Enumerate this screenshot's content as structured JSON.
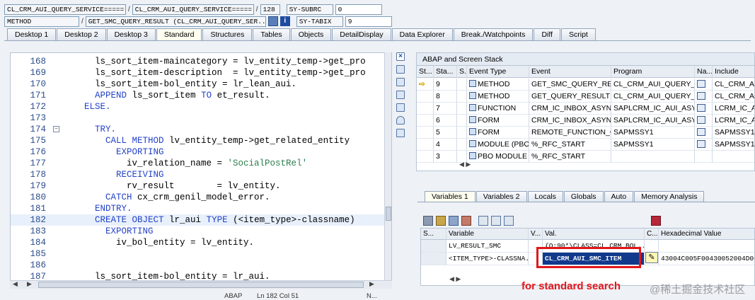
{
  "header": {
    "row1": {
      "field1": "CL_CRM_AUI_QUERY_SERVICE=====...",
      "field2": "CL_CRM_AUI_QUERY_SERVICE=====...",
      "line": "128",
      "sys_field": "SY-SUBRC",
      "sys_value": "0"
    },
    "row2": {
      "kind": "METHOD",
      "method": "GET_SMC_QUERY_RESULT (CL_CRM_AUI_QUERY_SER...",
      "sys_field": "SY-TABIX",
      "sys_value": "9"
    }
  },
  "tabs": [
    "Desktop 1",
    "Desktop 2",
    "Desktop 3",
    "Standard",
    "Structures",
    "Tables",
    "Objects",
    "DetailDisplay",
    "Data Explorer",
    "Break./Watchpoints",
    "Diff",
    "Script"
  ],
  "active_tab": "Standard",
  "code": [
    {
      "n": "168",
      "t": "      ls_sort_item-maincategory = lv_entity_temp->get_pro"
    },
    {
      "n": "169",
      "t": "      ls_sort_item-description  = lv_entity_temp->get_pro"
    },
    {
      "n": "170",
      "t": "      ls_sort_item-bol_entity = lr_lean_aui."
    },
    {
      "n": "171",
      "k": "APPEND",
      "t": " ls_sort_item ",
      "k2": "TO",
      "t2": " et_result.",
      "i": "      "
    },
    {
      "n": "172",
      "k": "ELSE.",
      "i": "    "
    },
    {
      "n": "173",
      "t": ""
    },
    {
      "n": "174",
      "k": "TRY.",
      "i": "      "
    },
    {
      "n": "175",
      "k": "CALL METHOD",
      "t": " lv_entity_temp->get_related_entity",
      "i": "        "
    },
    {
      "n": "176",
      "k": "EXPORTING",
      "i": "          "
    },
    {
      "n": "177",
      "t": "            iv_relation_name = ",
      "s": "'SocialPostRel'"
    },
    {
      "n": "178",
      "k": "RECEIVING",
      "i": "          "
    },
    {
      "n": "179",
      "t": "            rv_result        = lv_entity."
    },
    {
      "n": "180",
      "k": "CATCH",
      "t": " cx_crm_genil_model_error.",
      "i": "        "
    },
    {
      "n": "181",
      "k": "ENDTRY.",
      "i": "      "
    },
    {
      "n": "182",
      "k": "CREATE OBJECT",
      "t": " lr_aui ",
      "k2": "TYPE",
      "t2": " (<item_type>-classname)",
      "i": "      "
    },
    {
      "n": "183",
      "k": "EXPORTING",
      "i": "        "
    },
    {
      "n": "184",
      "t": "          iv_bol_entity = lv_entity."
    },
    {
      "n": "185",
      "t": ""
    },
    {
      "n": "186",
      "t": ""
    },
    {
      "n": "187",
      "t": "      ls_sort_item-bol_entity = lr_aui."
    }
  ],
  "status": {
    "lang": "ABAP",
    "pos": "Ln 182 Col  51",
    "ins": "N..."
  },
  "stack": {
    "title": "ABAP and Screen Stack",
    "columns": [
      "St...",
      "Sta...",
      "S...",
      "Event Type",
      "Event",
      "Program",
      "Na...",
      "Include"
    ],
    "rows": [
      {
        "cur": true,
        "level": "9",
        "type": "METHOD",
        "event": "GET_SMC_QUERY_RESU...",
        "program": "CL_CRM_AUI_QUERY_SE...",
        "include": "CL_CRM_AUI_"
      },
      {
        "cur": false,
        "level": "8",
        "type": "METHOD",
        "event": "GET_QUERY_RESULT",
        "program": "CL_CRM_AUI_QUERY_SE...",
        "include": "CL_CRM_AUI_"
      },
      {
        "cur": false,
        "level": "7",
        "type": "FUNCTION",
        "event": "CRM_IC_INBOX_ASYN_S...",
        "program": "SAPLCRM_IC_AUI_ASYN",
        "include": "LCRM_IC_AU"
      },
      {
        "cur": false,
        "level": "6",
        "type": "FORM",
        "event": "CRM_IC_INBOX_ASYN_S...",
        "program": "SAPLCRM_IC_AUI_ASYN",
        "include": "LCRM_IC_AU"
      },
      {
        "cur": false,
        "level": "5",
        "type": "FORM",
        "event": "REMOTE_FUNCTION_CA...",
        "program": "SAPMSSY1",
        "include": "SAPMSSY1"
      },
      {
        "cur": false,
        "level": "4",
        "type": "MODULE (PBO)",
        "event": "%_RFC_START",
        "program": "SAPMSSY1",
        "include": "SAPMSSY1"
      },
      {
        "cur": false,
        "level": "3",
        "type": "PBO MODULE",
        "event": "%_RFC_START",
        "program": "",
        "include": ""
      }
    ]
  },
  "var_tabs": [
    "Variables 1",
    "Variables 2",
    "Locals",
    "Globals",
    "Auto",
    "Memory Analysis"
  ],
  "active_var_tab": "Variables 1",
  "variables": {
    "columns": [
      "S...",
      "Variable",
      "V...",
      "Val.",
      "C...",
      "Hexadecimal Value"
    ],
    "rows": [
      {
        "name": "LV_RESULT_SMC",
        "value": "{O:90*\\CLASS=CL_CRM_BOL...",
        "hex": ""
      },
      {
        "name": "<ITEM_TYPE>-CLASSNA...",
        "value": "CL_CRM_AUI_SMC_ITEM",
        "hex": "43004C005F00430052004D00"
      }
    ]
  },
  "caption": "for standard search",
  "watermark": "@稀土掘金技术社区",
  "colors": {
    "keyword": "#2443c8",
    "string": "#2c7d4c",
    "highlight_box": "#e2161a",
    "selection": "#123a8c"
  }
}
